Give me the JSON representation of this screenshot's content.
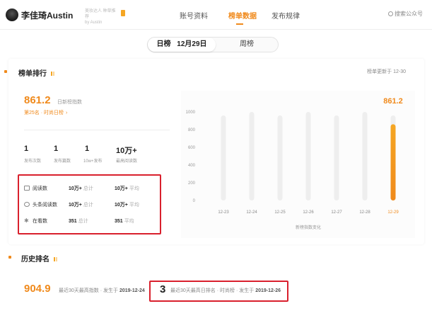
{
  "account": {
    "name": "李佳琦Austin",
    "sub_line1": "美妆达人 种草推荐",
    "sub_line2": "by Austin"
  },
  "nav": {
    "items": [
      {
        "label": "账号资料",
        "active": false
      },
      {
        "label": "榜单数据",
        "active": true
      },
      {
        "label": "发布规律",
        "active": false
      }
    ],
    "search_label": "搜索公众号"
  },
  "toggle": {
    "day_label": "日榜",
    "day_date": "12月29日",
    "week_label": "周榜"
  },
  "ranking": {
    "title": "榜单排行",
    "update_note": "榜单更新于 12-30",
    "index_value": "861.2",
    "index_label": "日新榜指数",
    "rank_text": "第25名 · 时尚日榜",
    "rank_arrow": "›",
    "stats": [
      {
        "value": "1",
        "label": "发布次数"
      },
      {
        "value": "1",
        "label": "发布篇数"
      },
      {
        "value": "1",
        "label": "10w+发布"
      },
      {
        "value": "10万+",
        "label": "最高阅读数"
      }
    ],
    "details": [
      {
        "icon": "document-icon",
        "label": "阅读数",
        "total": "10万+",
        "total_unit": "总计",
        "avg": "10万+",
        "avg_unit": "平均"
      },
      {
        "icon": "headline-icon",
        "label": "头条阅读数",
        "total": "10万+",
        "total_unit": "总计",
        "avg": "10万+",
        "avg_unit": "平均"
      },
      {
        "icon": "gear-icon",
        "label": "在看数",
        "total": "351",
        "total_unit": "总计",
        "avg": "351",
        "avg_unit": "平均"
      }
    ]
  },
  "chart_data": {
    "type": "bar",
    "categories": [
      "12-23",
      "12-24",
      "12-25",
      "12-26",
      "12-27",
      "12-28",
      "12-29"
    ],
    "values": [
      null,
      null,
      null,
      null,
      null,
      null,
      861.2
    ],
    "highlight_index": 6,
    "highlight_label": "861.2",
    "yticks": [
      0,
      200,
      400,
      600,
      800,
      1000
    ],
    "ylim": [
      0,
      1000
    ],
    "xlabel": "新榜指数变化",
    "colors": {
      "bar_background": "#eeeeee",
      "highlight_top": "#f5a623",
      "highlight_bottom": "#f08a1c",
      "accent": "#f08a1c"
    }
  },
  "history": {
    "title": "历史排名",
    "best_index": "904.9",
    "best_index_desc": "最近30天最高指数 · 发生于",
    "best_index_date": "2019-12-24",
    "best_rank": "3",
    "best_rank_desc": "最近30天最高日排名 · 时尚榜 · 发生于",
    "best_rank_date": "2019-12-26"
  }
}
